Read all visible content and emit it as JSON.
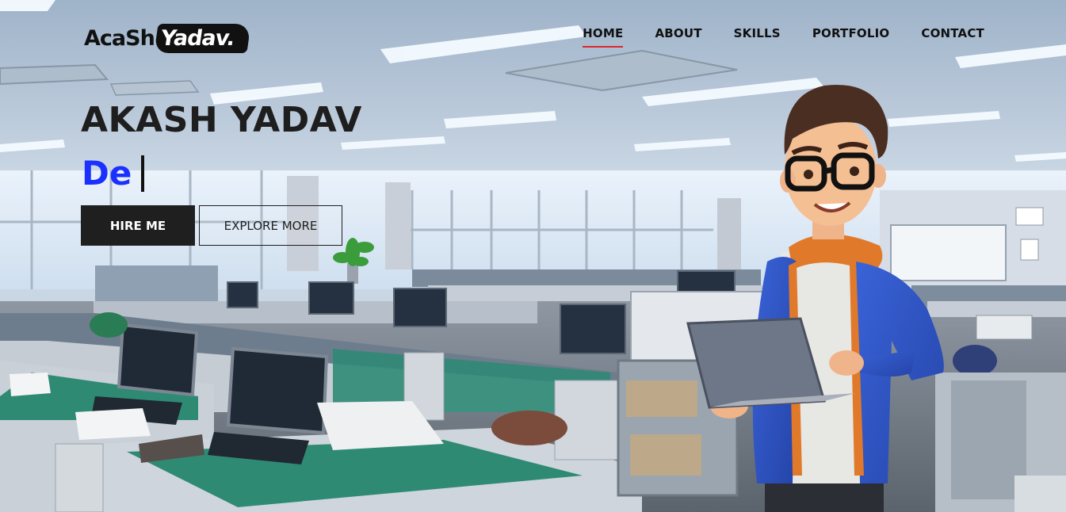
{
  "logo": {
    "part1": "AcaSh",
    "part2": "Yadav."
  },
  "nav": [
    {
      "label": "HOME",
      "active": true
    },
    {
      "label": "ABOUT",
      "active": false
    },
    {
      "label": "SKILLS",
      "active": false
    },
    {
      "label": "PORTFOLIO",
      "active": false
    },
    {
      "label": "CONTACT",
      "active": false
    }
  ],
  "hero": {
    "name": "AKASH YADAV",
    "typed_role": "De",
    "hire_label": "HIRE ME",
    "explore_label": "EXPLORE MORE"
  },
  "colors": {
    "accent": "#1b30ff",
    "nav_underline": "#e0262c",
    "dark": "#1f1f1f"
  }
}
